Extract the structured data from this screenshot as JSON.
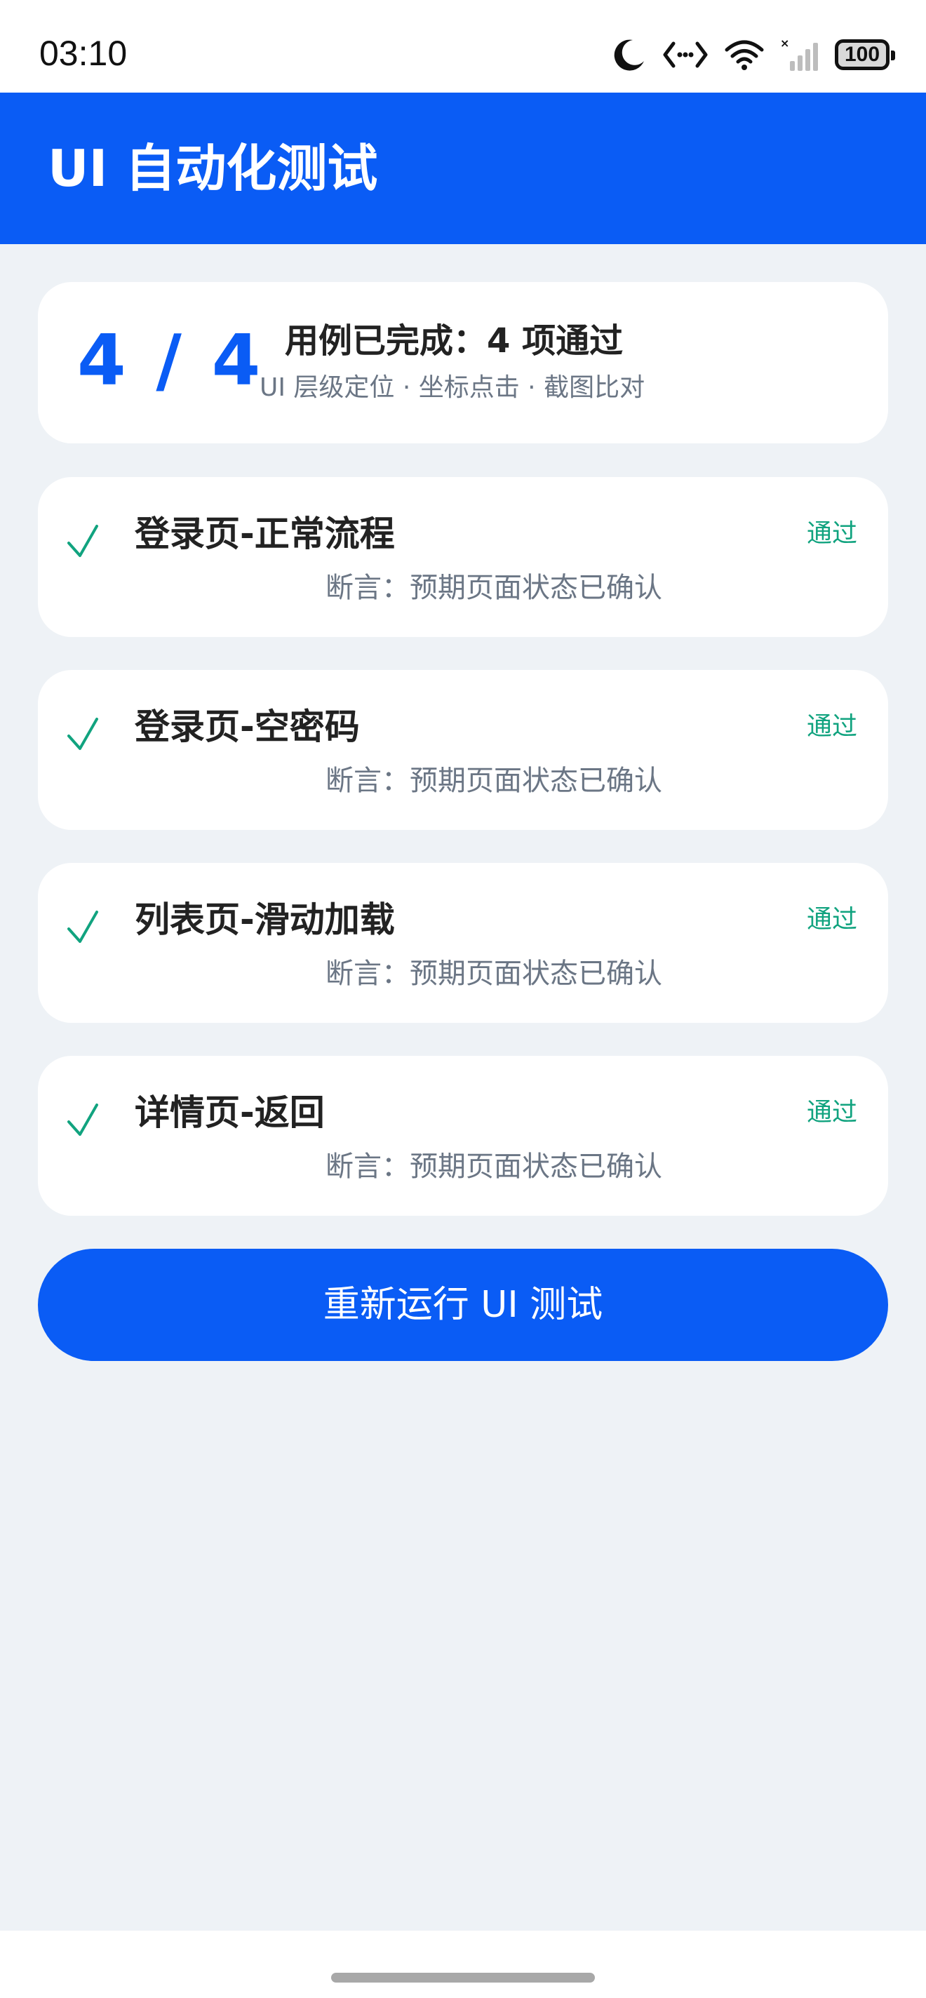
{
  "status_bar": {
    "time": "03:10",
    "battery": "100",
    "icons": [
      "moon-icon",
      "code-icon",
      "wifi-icon",
      "signal-icon",
      "battery-icon"
    ]
  },
  "app_bar": {
    "title": "UI 自动化测试"
  },
  "summary": {
    "count": "4 / 4",
    "title": "用例已完成：4 项通过",
    "subtitle": "UI 层级定位 · 坐标点击 · 截图比对"
  },
  "cases": [
    {
      "name": "登录页-正常流程",
      "assertion": "断言：预期页面状态已确认",
      "status": "通过"
    },
    {
      "name": "登录页-空密码",
      "assertion": "断言：预期页面状态已确认",
      "status": "通过"
    },
    {
      "name": "列表页-滑动加载",
      "assertion": "断言：预期页面状态已确认",
      "status": "通过"
    },
    {
      "name": "详情页-返回",
      "assertion": "断言：预期页面状态已确认",
      "status": "通过"
    }
  ],
  "rerun_button": {
    "label": "重新运行 UI 测试"
  },
  "colors": {
    "primary": "#0a5cf5",
    "success": "#11a37f",
    "background": "#eef2f6"
  }
}
